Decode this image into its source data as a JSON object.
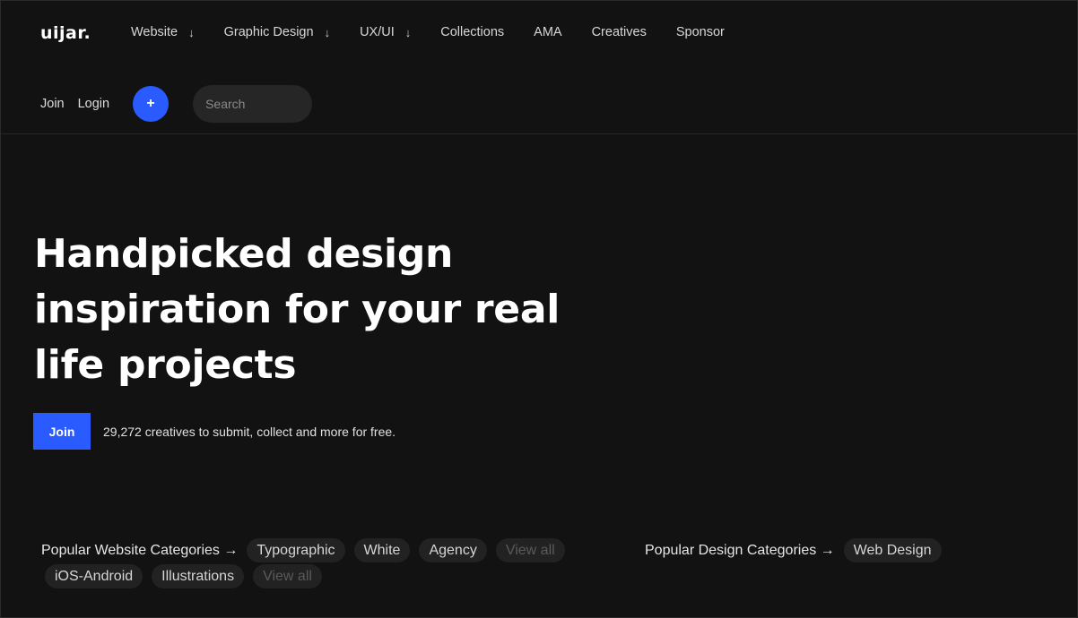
{
  "header": {
    "logo": "uijar.",
    "nav": [
      {
        "label": "Website",
        "arrow": "↓"
      },
      {
        "label": "Graphic Design",
        "arrow": "↓"
      },
      {
        "label": "UX/UI",
        "arrow": "↓"
      },
      {
        "label": "Collections"
      },
      {
        "label": "AMA"
      },
      {
        "label": "Creatives"
      },
      {
        "label": "Sponsor"
      }
    ],
    "join_label": "Join",
    "login_label": "Login",
    "plus_label": "+",
    "search_placeholder": "Search"
  },
  "hero": {
    "title": "Handpicked design inspiration for your real life projects",
    "join_label": "Join",
    "subtext": "29,272 creatives to submit, collect and more for free."
  },
  "website_categories": {
    "label": "Popular Website Categories →",
    "chips": [
      "Typographic",
      "White",
      "Agency"
    ],
    "view_all": "View all",
    "row2_chips": [
      "iOS-Android",
      "Illustrations"
    ],
    "row2_view_all": "View all"
  },
  "design_categories": {
    "label": "Popular Design Categories →",
    "chips": [
      "Web Design"
    ]
  },
  "colors": {
    "background": "#121212",
    "accent": "#2a5bff",
    "chip": "#222222"
  }
}
